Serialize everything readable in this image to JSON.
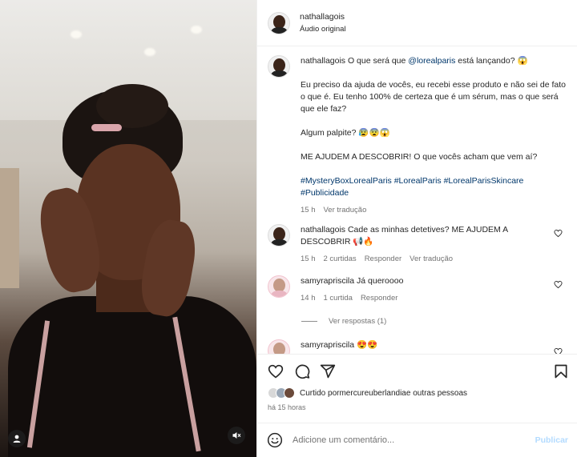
{
  "post": {
    "author": "nathallagois",
    "audio": "Áudio original"
  },
  "caption": {
    "username": "nathallagois",
    "line1_pre": "O que será que ",
    "mention": "@lorealparis",
    "line1_post": " está lançando? 😱",
    "para2": "Eu preciso da ajuda de vocês, eu recebi esse produto e não sei de fato o que é. Eu tenho 100% de certeza que é um sérum, mas o que será que ele faz?",
    "para3": "Algum palpite? 😰😨😱",
    "para4": "ME AJUDEM A DESCOBRIR! O que vocês acham que vem aí?",
    "hashtags": "#MysteryBoxLorealParis #LorealParis #LorealParisSkincare #Publicidade",
    "time": "15 h",
    "translate": "Ver tradução"
  },
  "comments": [
    {
      "username": "nathallagois",
      "text": "Cade as minhas detetives? ME AJUDEM A DESCOBRIR 📢🔥",
      "time": "15 h",
      "likes": "2 curtidas",
      "reply": "Responder",
      "translate": "Ver tradução"
    },
    {
      "username": "samyrapriscila",
      "text": "Já queroooo",
      "time": "14 h",
      "likes": "1 curtida",
      "reply": "Responder",
      "view_replies": "Ver respostas (1)"
    },
    {
      "username": "samyrapriscila",
      "text": "😍😍"
    }
  ],
  "liked_by": {
    "prefix": "Curtido por ",
    "user": "mercureuberlandia",
    "suffix": " e outras pessoas"
  },
  "posted_ago": "há 15 horas",
  "composer": {
    "placeholder": "Adicione um comentário...",
    "publish": "Publicar"
  },
  "icons": [
    "user-icon",
    "mute-icon",
    "heart-icon",
    "comment-icon",
    "share-icon",
    "bookmark-icon",
    "emoji-icon"
  ],
  "colors": {
    "link": "#00376b",
    "muted": "#737373",
    "publish_disabled": "#b3dbff"
  }
}
